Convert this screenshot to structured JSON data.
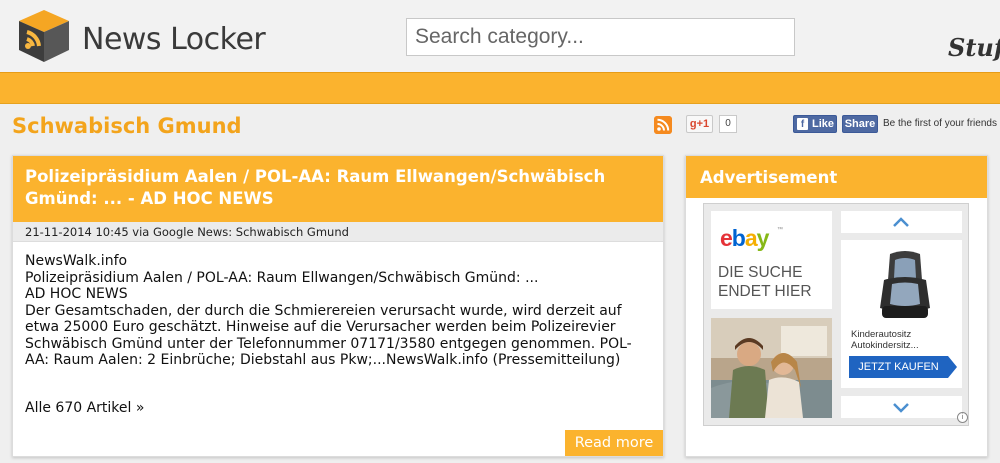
{
  "header": {
    "logo_text": "News Locker",
    "search_placeholder": "Search category...",
    "tagline": "Stuff"
  },
  "page": {
    "title": "Schwabisch Gmund"
  },
  "social": {
    "gplus_label": "g+1",
    "gplus_count": "0",
    "fb_like_label": "Like",
    "fb_share_label": "Share",
    "fb_prompt": "Be the first of your friends"
  },
  "article": {
    "title": "Polizeipräsidium Aalen / POL-AA: Raum Ellwangen/Schwäbisch Gmünd: ... - AD HOC NEWS",
    "meta": "21-11-2014 10:45 via Google News: Schwabisch Gmund",
    "body_lines": [
      "NewsWalk.info",
      "Polizeipräsidium Aalen / POL-AA: Raum Ellwangen/Schwäbisch Gmünd: ...",
      "AD HOC NEWS",
      "Der Gesamtschaden, der durch die Schmierereien verursacht wurde, wird derzeit auf etwa 25000 Euro geschätzt. Hinweise auf die Verursacher werden beim Polizeirevier Schwäbisch Gmünd unter der Telefonnummer 07171/3580 entgegen genommen. POL-AA: Raum Aalen: 2 Einbrüche; Diebstahl aus Pkw;...NewsWalk.info (Pressemitteilung)"
    ],
    "all_link": "Alle 670 Artikel »",
    "read_more": "Read more"
  },
  "ad": {
    "title": "Advertisement",
    "brand": [
      "e",
      "b",
      "a",
      "y"
    ],
    "brand_tm": "™",
    "slogan": "DIE SUCHE ENDET HIER",
    "product_name_1": "Kinderautositz",
    "product_name_2": "Autokindersitz...",
    "cta": "JETZT KAUFEN",
    "info": "i"
  },
  "colors": {
    "accent": "#fbb32e",
    "title_orange": "#f3a41c",
    "facebook": "#4e69a2",
    "ebay_blue_button": "#1f64c1"
  }
}
